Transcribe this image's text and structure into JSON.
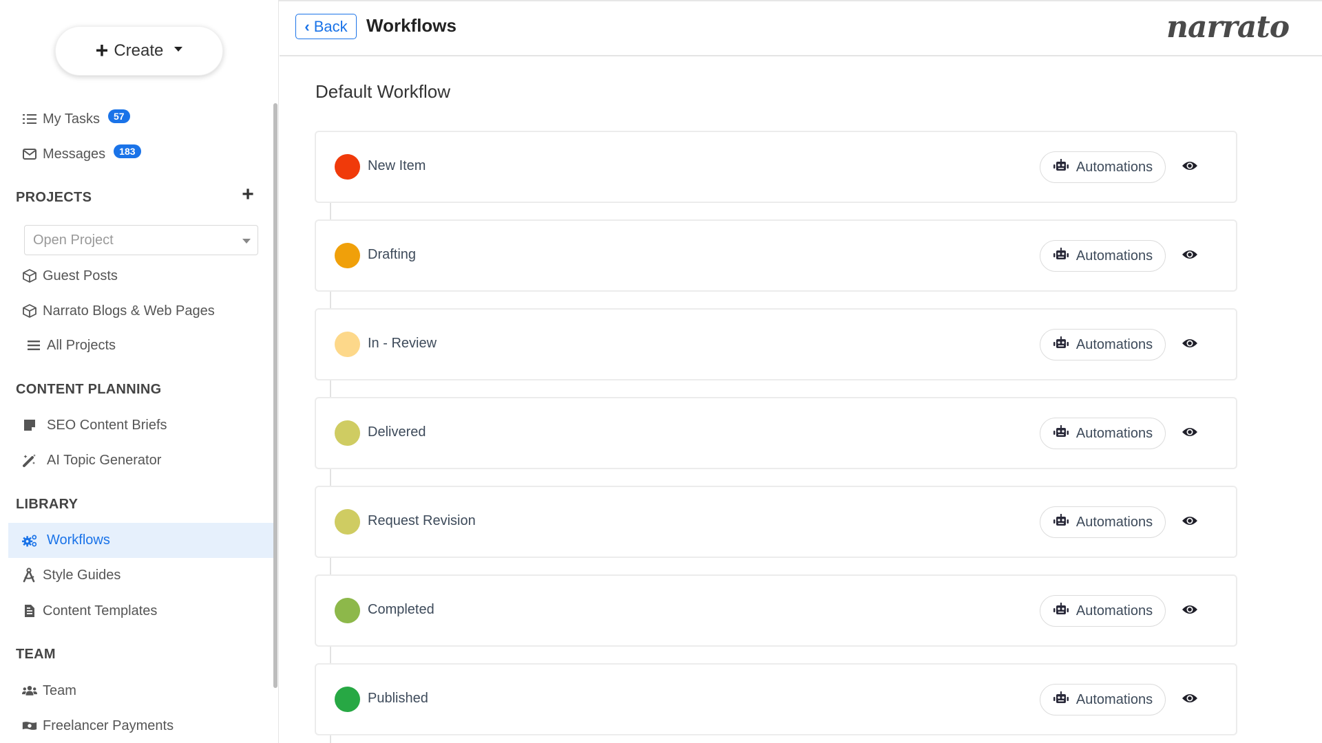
{
  "sidebar": {
    "create_label": "Create",
    "my_tasks": {
      "label": "My Tasks",
      "count": "57"
    },
    "messages": {
      "label": "Messages",
      "count": "183"
    },
    "projects": {
      "title": "PROJECTS",
      "open_project_placeholder": "Open Project",
      "items": [
        {
          "label": "Guest Posts",
          "icon": "cube-icon"
        },
        {
          "label": "Narrato Blogs & Web Pages",
          "icon": "cube-icon"
        },
        {
          "label": "All Projects",
          "icon": "list-icon"
        }
      ]
    },
    "content_planning": {
      "title": "CONTENT PLANNING",
      "items": [
        {
          "label": "SEO Content Briefs",
          "icon": "sticky-note-icon"
        },
        {
          "label": "AI Topic Generator",
          "icon": "magic-wand-icon"
        }
      ]
    },
    "library": {
      "title": "LIBRARY",
      "items": [
        {
          "label": "Workflows",
          "icon": "gears-icon",
          "active": true
        },
        {
          "label": "Style Guides",
          "icon": "compass-drafting-icon"
        },
        {
          "label": "Content Templates",
          "icon": "file-icon"
        }
      ]
    },
    "team": {
      "title": "TEAM",
      "items": [
        {
          "label": "Team",
          "icon": "users-icon"
        },
        {
          "label": "Freelancer Payments",
          "icon": "money-bill-icon"
        }
      ]
    }
  },
  "header": {
    "back_label": "Back",
    "title": "Workflows",
    "logo": "narrato"
  },
  "main": {
    "workflow_title": "Default Workflow",
    "automations_label": "Automations",
    "stages": [
      {
        "name": "New Item",
        "color": "#f03a0a"
      },
      {
        "name": "Drafting",
        "color": "#f0a00a"
      },
      {
        "name": "In - Review",
        "color": "#fdd88a"
      },
      {
        "name": "Delivered",
        "color": "#cfcc62"
      },
      {
        "name": "Request Revision",
        "color": "#cfcc62"
      },
      {
        "name": "Completed",
        "color": "#8db84a"
      },
      {
        "name": "Published",
        "color": "#27a844"
      }
    ]
  },
  "colors": {
    "accent": "#1a73e8",
    "active_bg": "#e6f0fc"
  }
}
